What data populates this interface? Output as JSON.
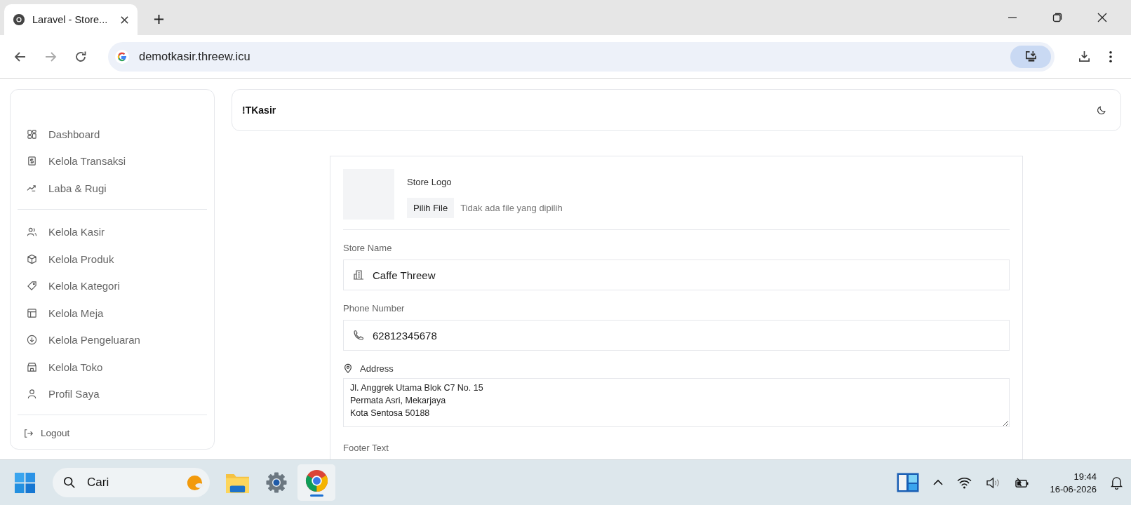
{
  "browser": {
    "tab_title": "Laravel - Store...",
    "url": "demotkasir.threew.icu"
  },
  "sidebar": {
    "groups": [
      {
        "items": [
          {
            "label": "Dashboard"
          },
          {
            "label": "Kelola Transaksi"
          },
          {
            "label": "Laba & Rugi"
          }
        ]
      },
      {
        "items": [
          {
            "label": "Kelola Kasir"
          },
          {
            "label": "Kelola Produk"
          },
          {
            "label": "Kelola Kategori"
          },
          {
            "label": "Kelola Meja"
          },
          {
            "label": "Kelola Pengeluaran"
          },
          {
            "label": "Kelola Toko"
          },
          {
            "label": "Profil Saya"
          }
        ]
      }
    ],
    "logout": "Logout"
  },
  "header": {
    "brand": "!TKasir"
  },
  "form": {
    "logo_label": "Store Logo",
    "file_button": "Pilih File",
    "file_status": "Tidak ada file yang dipilih",
    "store_name": {
      "label": "Store Name",
      "value": "Caffe Threew"
    },
    "phone": {
      "label": "Phone Number",
      "value": "62812345678"
    },
    "address": {
      "label": "Address",
      "value": "Jl. Anggrek Utama Blok C7 No. 15\nPermata Asri, Mekarjaya\nKota Sentosa 50188"
    },
    "footer_text": {
      "label": "Footer Text"
    }
  },
  "taskbar": {
    "search_placeholder": "Cari",
    "time": "19:44",
    "date": "16-06-2026"
  }
}
